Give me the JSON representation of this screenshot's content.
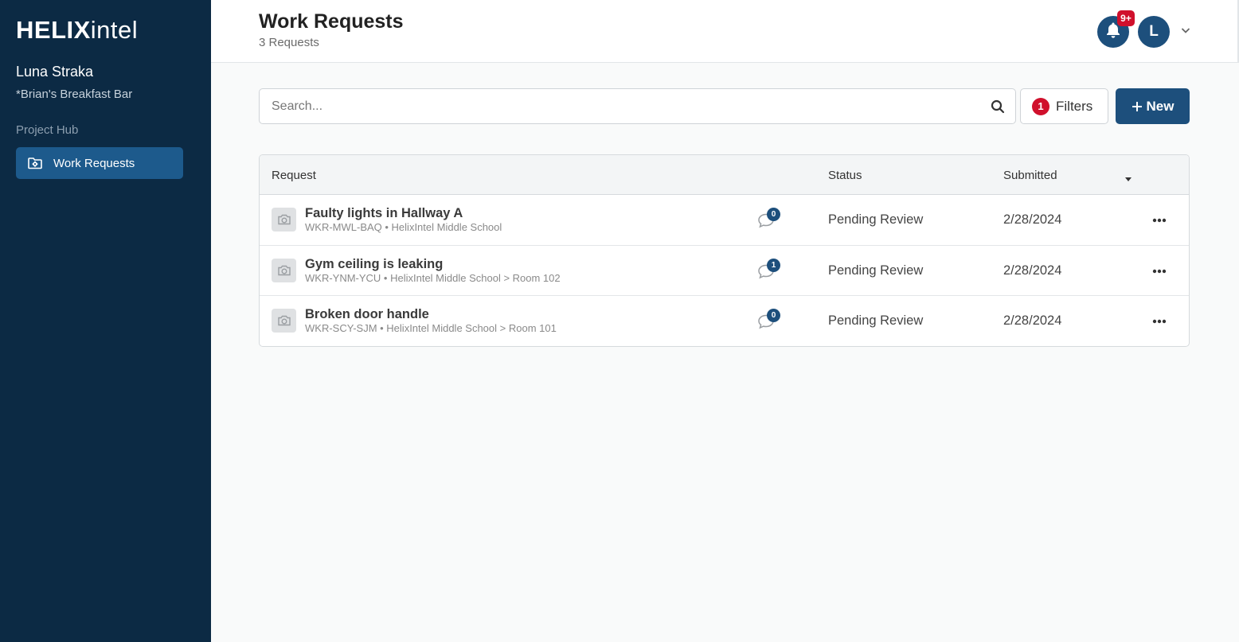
{
  "app": {
    "logo_bold": "HELIX",
    "logo_light": "intel"
  },
  "sidebar": {
    "user_name": "Luna Straka",
    "org_name": "*Brian's Breakfast Bar",
    "section_label": "Project Hub",
    "items": [
      {
        "label": "Work Requests",
        "icon": "folder-gear-icon",
        "active": true
      }
    ]
  },
  "header": {
    "title": "Work Requests",
    "subtitle": "3 Requests",
    "notifications_badge": "9+",
    "avatar_initial": "L"
  },
  "toolbar": {
    "search_placeholder": "Search...",
    "filters_count": "1",
    "filters_label": "Filters",
    "new_label": "New"
  },
  "table": {
    "columns": [
      "Request",
      "Status",
      "Submitted"
    ],
    "rows": [
      {
        "title": "Faulty lights in Hallway A",
        "meta": "WKR-MWL-BAQ • HelixIntel Middle School",
        "comments": "0",
        "status": "Pending Review",
        "submitted": "2/28/2024"
      },
      {
        "title": "Gym ceiling is leaking",
        "meta": "WKR-YNM-YCU • HelixIntel Middle School > Room 102",
        "comments": "1",
        "status": "Pending Review",
        "submitted": "2/28/2024"
      },
      {
        "title": "Broken door handle",
        "meta": "WKR-SCY-SJM • HelixIntel Middle School > Room 101",
        "comments": "0",
        "status": "Pending Review",
        "submitted": "2/28/2024"
      }
    ]
  },
  "colors": {
    "sidebar_bg": "#0c2a44",
    "accent": "#1d4f7c",
    "active_nav": "#1d5a8c",
    "badge_red": "#d0102c"
  }
}
